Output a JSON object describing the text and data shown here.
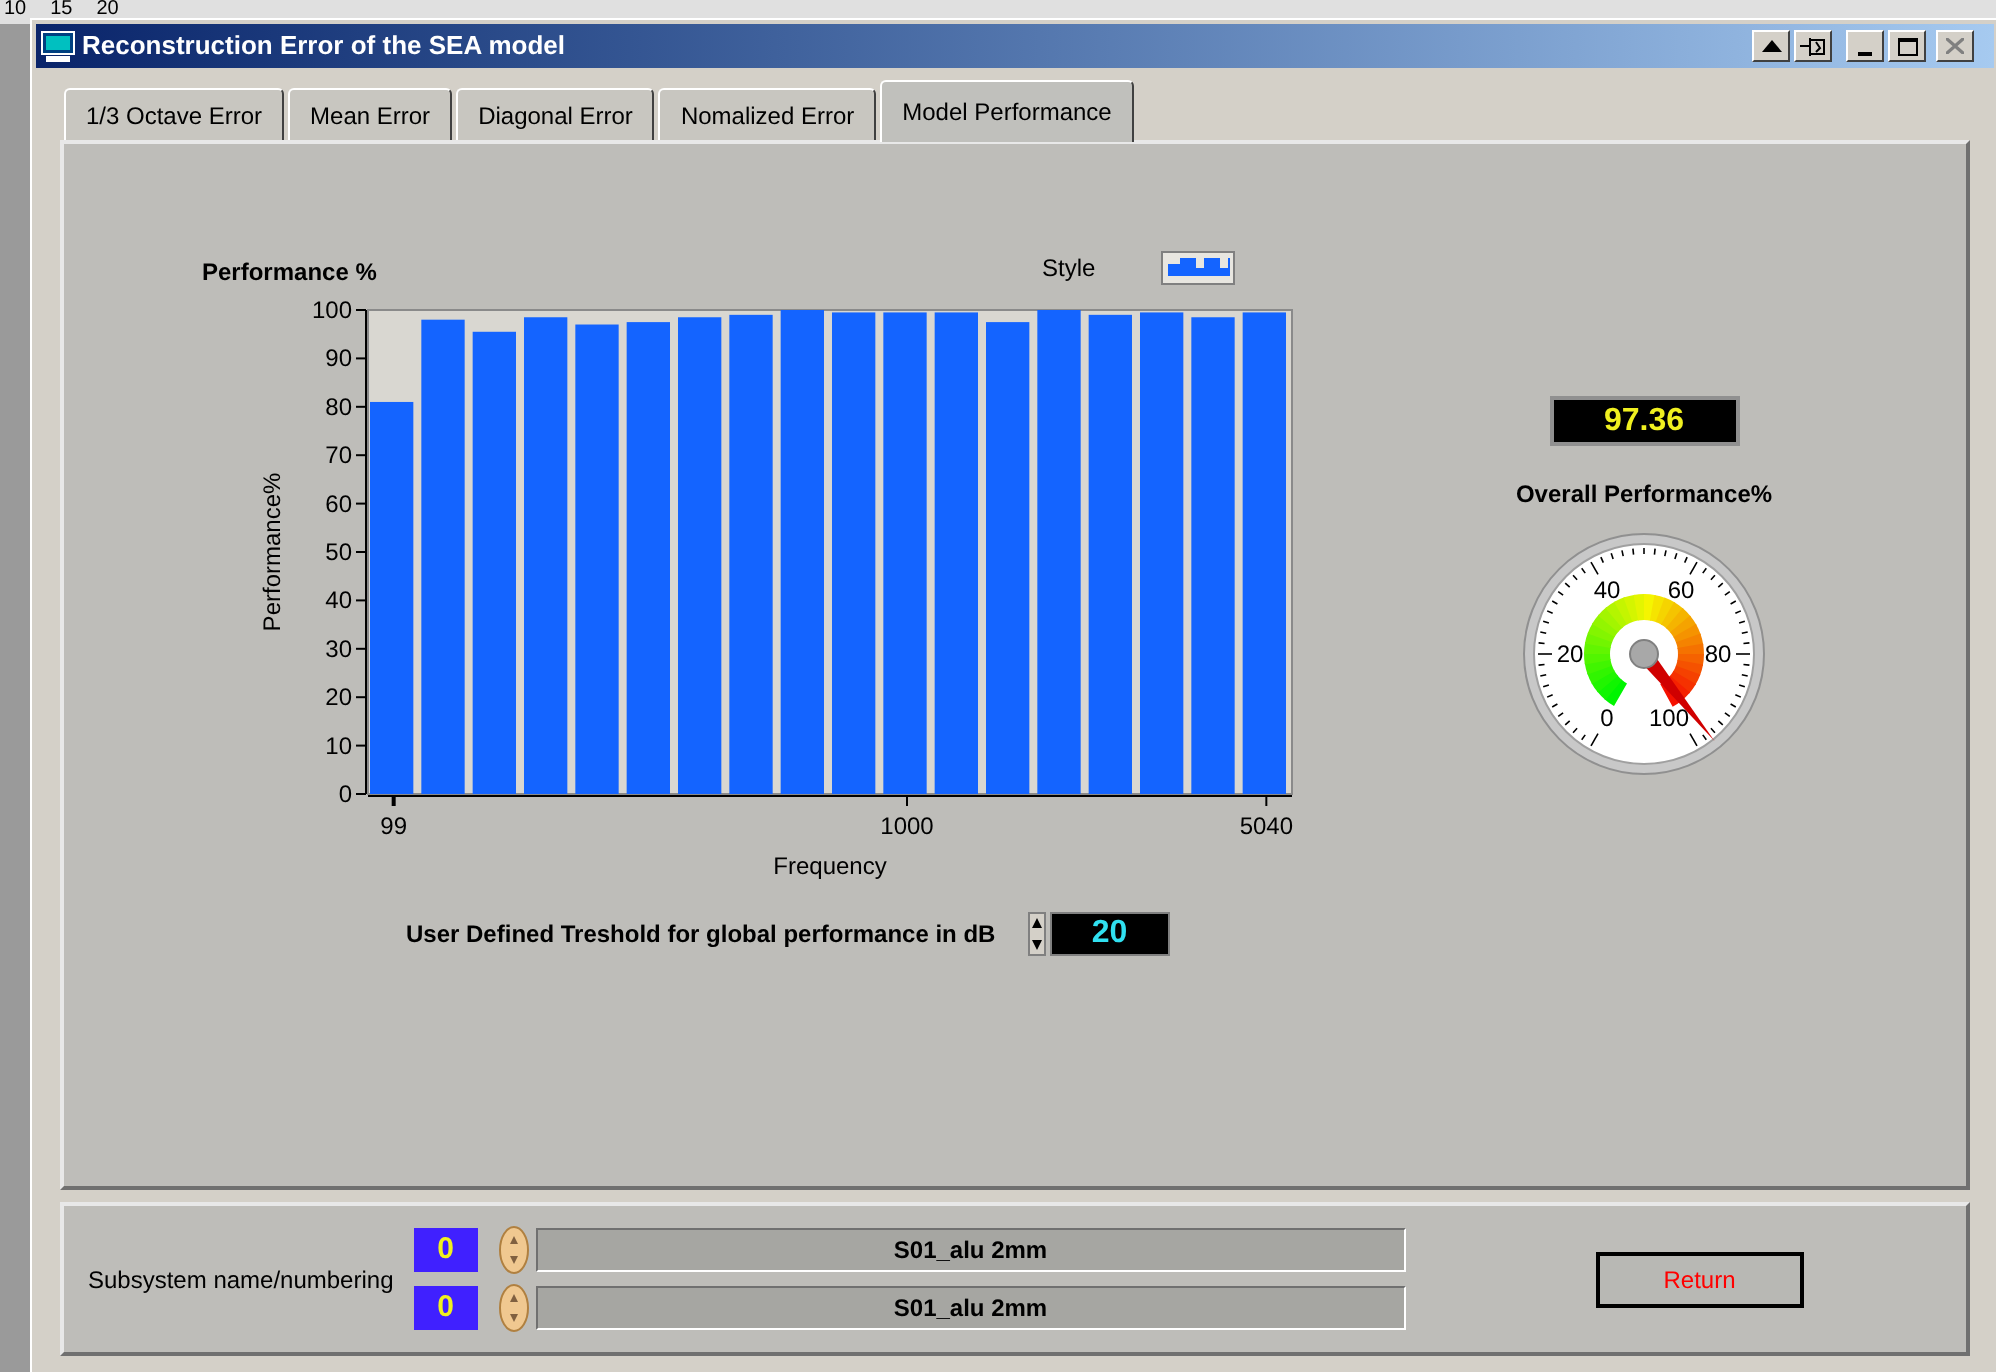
{
  "backdrop": {
    "ruler_labels": [
      "10",
      "15",
      "20"
    ]
  },
  "window": {
    "title": "Reconstruction Error of the SEA model"
  },
  "tabs": [
    {
      "label": "1/3 Octave Error",
      "selected": false
    },
    {
      "label": "Mean Error",
      "selected": false
    },
    {
      "label": "Diagonal Error",
      "selected": false
    },
    {
      "label": "Nomalized Error",
      "selected": false
    },
    {
      "label": "Model Performance",
      "selected": true
    }
  ],
  "chart": {
    "style_label": "Style",
    "chart_data": {
      "type": "bar",
      "title": "Performance %",
      "xlabel": "Frequency",
      "ylabel": "Performance%",
      "categories": [
        "99",
        null,
        null,
        null,
        null,
        null,
        null,
        null,
        null,
        null,
        "1000",
        null,
        null,
        null,
        null,
        null,
        null,
        "5040"
      ],
      "values": [
        81,
        98,
        95.5,
        98.5,
        97,
        97.5,
        98.5,
        99,
        100,
        99.5,
        99.5,
        99.5,
        97.5,
        100,
        99,
        99.5,
        98.5,
        99.5
      ],
      "ylim": [
        0,
        100
      ],
      "yticks": [
        0,
        10,
        20,
        30,
        40,
        50,
        60,
        70,
        80,
        90,
        100
      ]
    }
  },
  "threshold": {
    "label": "User Defined Treshold for global performance in dB",
    "value": "20"
  },
  "overall": {
    "value": "97.36",
    "label": "Overall Performance%",
    "scale_labels": [
      "0",
      "20",
      "40",
      "60",
      "80",
      "100"
    ]
  },
  "subsystem": {
    "label": "Subsystem name/numbering",
    "rows": [
      {
        "number": "0",
        "name": "S01_alu 2mm"
      },
      {
        "number": "0",
        "name": "S01_alu 2mm"
      }
    ]
  },
  "buttons": [
    {
      "label": "Return"
    }
  ]
}
